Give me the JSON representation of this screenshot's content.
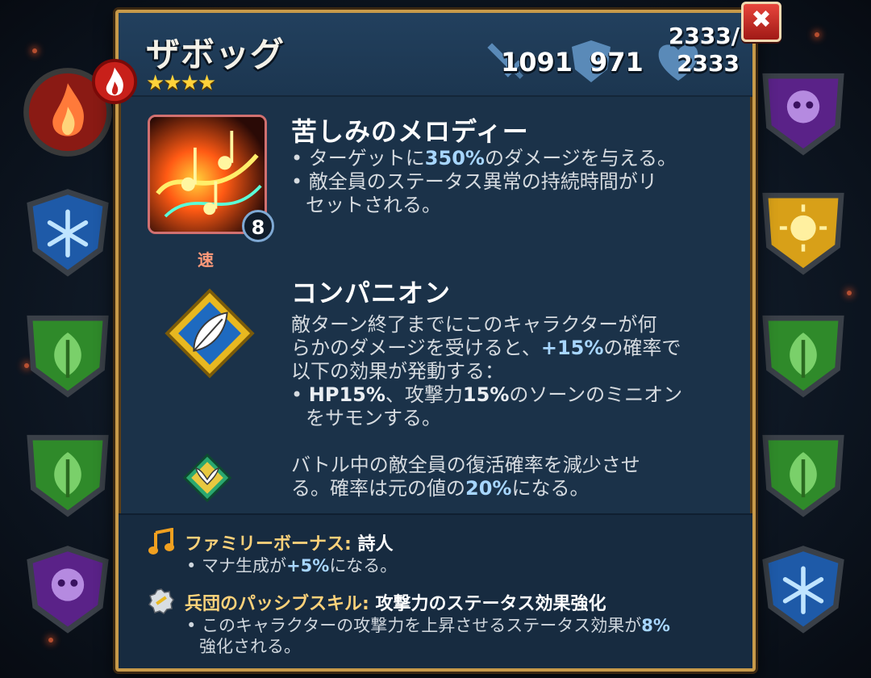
{
  "hero": {
    "name": "ザボッグ",
    "stars": "★★★★",
    "attack": "1091",
    "armor": "971",
    "hp_current": "2333/",
    "hp_max": "2333"
  },
  "spell": {
    "title": "苦しみのメロディー",
    "mana": "8",
    "speed": "速",
    "line1_pre": "• ターゲットに",
    "line1_hl": "350%",
    "line1_post": "のダメージを与える。",
    "line2": "• 敵全員のステータス異常の持続時間がリ",
    "line3": "セットされる。"
  },
  "companion": {
    "title": "コンパニオン",
    "line1": "敵ターン終了までにこのキャラクターが何",
    "line2_pre": "らかのダメージを受けると、",
    "line2_hl": "+15%",
    "line2_post": "の確率で",
    "line3": "以下の効果が発動する：",
    "line4_pre": "• ",
    "line4_b1": "HP15%",
    "line4_mid": "、攻撃力",
    "line4_b2": "15%",
    "line4_post": "のソーンのミニオン",
    "line5": "をサモンする。"
  },
  "passive": {
    "line1": "バトル中の敵全員の復活確率を減少させ",
    "line2_pre": "る。確率は元の値の",
    "line2_hl": "20%",
    "line2_post": "になる。"
  },
  "family": {
    "label": "ファミリーボーナス:",
    "value": "詩人",
    "text_pre": "• マナ生成が",
    "text_hl": "+5%",
    "text_post": "になる。"
  },
  "legion": {
    "label": "兵団のパッシブスキル:",
    "value": "攻撃力のステータス効果強化",
    "line1_pre": "• このキャラクターの攻撃力を上昇させるステータス効果が",
    "line1_hl": "8%",
    "line2": "強化される。"
  },
  "close_label": "✖",
  "colors": {
    "panel": "#1b3249",
    "border": "#c79a4a",
    "highlight": "#a7d6ff",
    "family": "#ffd27a"
  }
}
